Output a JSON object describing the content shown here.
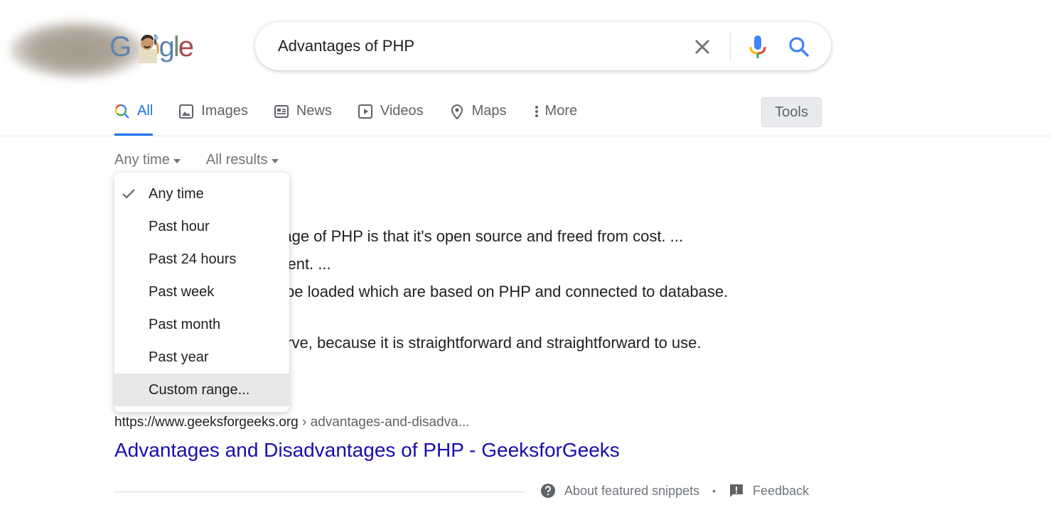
{
  "header": {
    "logo_letters": [
      "G",
      "o",
      "o",
      "g",
      "l",
      "e"
    ],
    "search_query": "Advantages of PHP"
  },
  "tabs": [
    {
      "label": "All",
      "icon": "search-multicolor-icon",
      "active": true
    },
    {
      "label": "Images",
      "icon": "image-icon"
    },
    {
      "label": "News",
      "icon": "newspaper-icon"
    },
    {
      "label": "Videos",
      "icon": "play-icon"
    },
    {
      "label": "Maps",
      "icon": "map-pin-icon"
    },
    {
      "label": "More",
      "icon": "vertical-dots-icon"
    }
  ],
  "tools_label": "Tools",
  "filters": {
    "time": "Any time",
    "results": "All results"
  },
  "time_dropdown": {
    "items": [
      {
        "label": "Any time",
        "checked": true
      },
      {
        "label": "Past hour"
      },
      {
        "label": "Past 24 hours"
      },
      {
        "label": "Past week"
      },
      {
        "label": "Past month"
      },
      {
        "label": "Past year"
      },
      {
        "label": "Custom range...",
        "hovered": true
      }
    ]
  },
  "snippet_lines": [
    "ntage of PHP is that it's open source and freed from cost. ...",
    "ndent. ...",
    "ly be loaded which are based on PHP and connected to database.",
    "curve, because it is straightforward and straightforward to use."
  ],
  "result": {
    "url_domain": "https://www.geeksforgeeks.org",
    "url_path": " › advantages-and-disadva...",
    "title": "Advantages and Disadvantages of PHP - GeeksforGeeks"
  },
  "footer": {
    "about_label": "About featured snippets",
    "separator": "•",
    "feedback_label": "Feedback"
  },
  "colors": {
    "accent_blue": "#1a73e8",
    "link_title": "#1a0dab",
    "text_primary": "#202124",
    "text_secondary": "#70757a"
  }
}
